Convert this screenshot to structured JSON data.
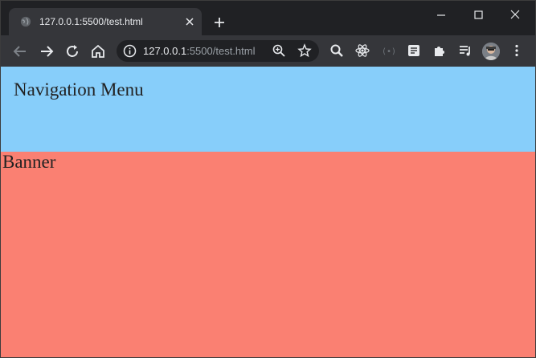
{
  "tab": {
    "title": "127.0.0.1:5500/test.html"
  },
  "omnibox": {
    "host": "127.0.0.1",
    "rest": ":5500/test.html"
  },
  "page": {
    "nav_text": "Navigation Menu",
    "banner_text": "Banner"
  },
  "colors": {
    "nav_bg": "#87cefa",
    "banner_bg": "#fa8072",
    "toolbar_bg": "#35363a",
    "tabstrip_bg": "#202124"
  },
  "icons": {
    "tab_favicon": "globe-icon",
    "back": "back-arrow-icon",
    "forward": "forward-arrow-icon",
    "reload": "reload-icon",
    "home": "home-icon",
    "info": "info-icon",
    "zoom": "zoom-icon",
    "bookmark": "star-icon",
    "extensions": [
      "search-extension-icon",
      "react-devtools-icon",
      "vue-devtools-icon",
      "reader-extension-icon",
      "puzzle-icon",
      "media-queue-icon"
    ],
    "menu": "more-vertical-icon"
  }
}
